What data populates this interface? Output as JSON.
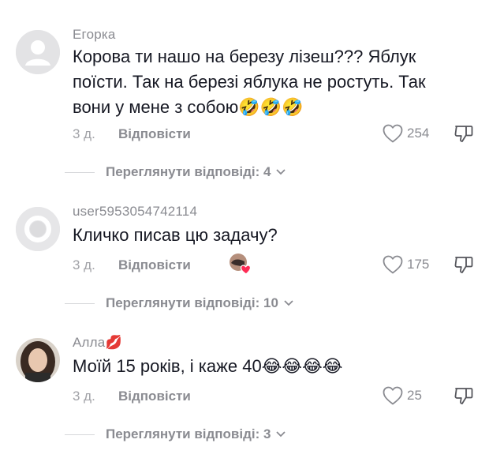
{
  "comments": [
    {
      "username": "Егорка",
      "text_lines": [
        "Корова ти нашо на березу лізеш??? Яблук",
        "поїсти. Так на березі яблука не ростуть. Так",
        "вони у мене з собою"
      ],
      "emojis": "🤣🤣🤣",
      "time": "3 д.",
      "reply_label": "Відповісти",
      "likes": "254",
      "view_replies": "Переглянути відповіді: 4"
    },
    {
      "username": "user5953054742114",
      "text": "Кличко писав цю задачу?",
      "time": "3 д.",
      "reply_label": "Відповісти",
      "likes": "175",
      "view_replies": "Переглянути відповіді: 10"
    },
    {
      "username": "Алла",
      "username_emoji": "💋",
      "text": "Моїй 15 років, і каже 40",
      "emojis": "😂😂😂😂",
      "time": "3 д.",
      "reply_label": "Відповісти",
      "likes": "25",
      "view_replies": "Переглянути відповіді: 3"
    }
  ],
  "colors": {
    "text": "#161823",
    "muted": "#8a8b91",
    "liked_heart": "#fe2c55"
  }
}
